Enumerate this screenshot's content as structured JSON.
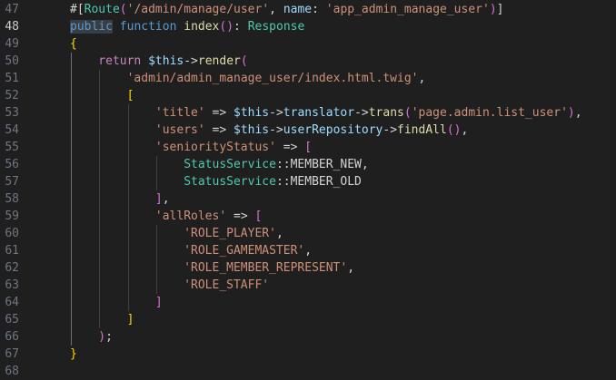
{
  "editor": {
    "theme": {
      "background": "#1f1f1f",
      "line_number": "#6e7681",
      "line_number_current": "#cccccc",
      "selection": "#3a3d41"
    },
    "current_line": 48,
    "lines": [
      {
        "number": "47",
        "indent": 0,
        "tokens": [
          {
            "t": "#[",
            "c": "c-punct"
          },
          {
            "t": "Route",
            "c": "c-type"
          },
          {
            "t": "(",
            "c": "c-b2"
          },
          {
            "t": "'/admin/manage/user'",
            "c": "c-str"
          },
          {
            "t": ", ",
            "c": "c-punct"
          },
          {
            "t": "name",
            "c": "c-var"
          },
          {
            "t": ": ",
            "c": "c-punct"
          },
          {
            "t": "'app_admin_manage_user'",
            "c": "c-str"
          },
          {
            "t": ")",
            "c": "c-b2"
          },
          {
            "t": "]",
            "c": "c-punct"
          }
        ]
      },
      {
        "number": "48",
        "indent": 0,
        "tokens": [
          {
            "t": "public",
            "c": "c-kw",
            "sel": true
          },
          {
            "t": " ",
            "c": "c-punct"
          },
          {
            "t": "function",
            "c": "c-kw"
          },
          {
            "t": " ",
            "c": "c-punct"
          },
          {
            "t": "index",
            "c": "c-fn"
          },
          {
            "t": "()",
            "c": "c-b2"
          },
          {
            "t": ": ",
            "c": "c-punct"
          },
          {
            "t": "Response",
            "c": "c-type"
          }
        ]
      },
      {
        "number": "49",
        "indent": 0,
        "tokens": [
          {
            "t": "{",
            "c": "c-b1"
          }
        ]
      },
      {
        "number": "50",
        "indent": 1,
        "tokens": [
          {
            "t": "return",
            "c": "c-ctrl"
          },
          {
            "t": " ",
            "c": "c-punct"
          },
          {
            "t": "$this",
            "c": "c-var"
          },
          {
            "t": "->",
            "c": "c-punct"
          },
          {
            "t": "render",
            "c": "c-fn"
          },
          {
            "t": "(",
            "c": "c-b2"
          }
        ]
      },
      {
        "number": "51",
        "indent": 2,
        "tokens": [
          {
            "t": "'admin/admin_manage_user/index.html.twig'",
            "c": "c-str"
          },
          {
            "t": ",",
            "c": "c-punct"
          }
        ]
      },
      {
        "number": "52",
        "indent": 2,
        "tokens": [
          {
            "t": "[",
            "c": "c-b1"
          }
        ]
      },
      {
        "number": "53",
        "indent": 3,
        "tokens": [
          {
            "t": "'title'",
            "c": "c-str"
          },
          {
            "t": " => ",
            "c": "c-punct"
          },
          {
            "t": "$this",
            "c": "c-var"
          },
          {
            "t": "->",
            "c": "c-punct"
          },
          {
            "t": "translator",
            "c": "c-var"
          },
          {
            "t": "->",
            "c": "c-punct"
          },
          {
            "t": "trans",
            "c": "c-fn"
          },
          {
            "t": "(",
            "c": "c-b2"
          },
          {
            "t": "'page.admin.list_user'",
            "c": "c-str"
          },
          {
            "t": ")",
            "c": "c-b2"
          },
          {
            "t": ",",
            "c": "c-punct"
          }
        ]
      },
      {
        "number": "54",
        "indent": 3,
        "tokens": [
          {
            "t": "'users'",
            "c": "c-str"
          },
          {
            "t": " => ",
            "c": "c-punct"
          },
          {
            "t": "$this",
            "c": "c-var"
          },
          {
            "t": "->",
            "c": "c-punct"
          },
          {
            "t": "userRepository",
            "c": "c-var"
          },
          {
            "t": "->",
            "c": "c-punct"
          },
          {
            "t": "findAll",
            "c": "c-fn"
          },
          {
            "t": "()",
            "c": "c-b2"
          },
          {
            "t": ",",
            "c": "c-punct"
          }
        ]
      },
      {
        "number": "55",
        "indent": 3,
        "tokens": [
          {
            "t": "'seniorityStatus'",
            "c": "c-str"
          },
          {
            "t": " => ",
            "c": "c-punct"
          },
          {
            "t": "[",
            "c": "c-b2"
          }
        ]
      },
      {
        "number": "56",
        "indent": 4,
        "tokens": [
          {
            "t": "StatusService",
            "c": "c-type"
          },
          {
            "t": "::",
            "c": "c-punct"
          },
          {
            "t": "MEMBER_NEW",
            "c": "c-const"
          },
          {
            "t": ",",
            "c": "c-punct"
          }
        ]
      },
      {
        "number": "57",
        "indent": 4,
        "tokens": [
          {
            "t": "StatusService",
            "c": "c-type"
          },
          {
            "t": "::",
            "c": "c-punct"
          },
          {
            "t": "MEMBER_OLD",
            "c": "c-const"
          }
        ]
      },
      {
        "number": "58",
        "indent": 3,
        "tokens": [
          {
            "t": "]",
            "c": "c-b2"
          },
          {
            "t": ",",
            "c": "c-punct"
          }
        ]
      },
      {
        "number": "59",
        "indent": 3,
        "tokens": [
          {
            "t": "'allRoles'",
            "c": "c-str"
          },
          {
            "t": " => ",
            "c": "c-punct"
          },
          {
            "t": "[",
            "c": "c-b2"
          }
        ]
      },
      {
        "number": "60",
        "indent": 4,
        "tokens": [
          {
            "t": "'ROLE_PLAYER'",
            "c": "c-str"
          },
          {
            "t": ",",
            "c": "c-punct"
          }
        ]
      },
      {
        "number": "61",
        "indent": 4,
        "tokens": [
          {
            "t": "'ROLE_GAMEMASTER'",
            "c": "c-str"
          },
          {
            "t": ",",
            "c": "c-punct"
          }
        ]
      },
      {
        "number": "62",
        "indent": 4,
        "tokens": [
          {
            "t": "'ROLE_MEMBER_REPRESENT'",
            "c": "c-str"
          },
          {
            "t": ",",
            "c": "c-punct"
          }
        ]
      },
      {
        "number": "63",
        "indent": 4,
        "tokens": [
          {
            "t": "'ROLE_STAFF'",
            "c": "c-str"
          }
        ]
      },
      {
        "number": "64",
        "indent": 3,
        "tokens": [
          {
            "t": "]",
            "c": "c-b2"
          }
        ]
      },
      {
        "number": "65",
        "indent": 2,
        "tokens": [
          {
            "t": "]",
            "c": "c-b1"
          }
        ]
      },
      {
        "number": "66",
        "indent": 1,
        "tokens": [
          {
            "t": ")",
            "c": "c-b2"
          },
          {
            "t": ";",
            "c": "c-punct"
          }
        ]
      },
      {
        "number": "67",
        "indent": 0,
        "tokens": [
          {
            "t": "}",
            "c": "c-b1"
          }
        ]
      },
      {
        "number": "68",
        "indent": 0,
        "tokens": []
      }
    ]
  }
}
